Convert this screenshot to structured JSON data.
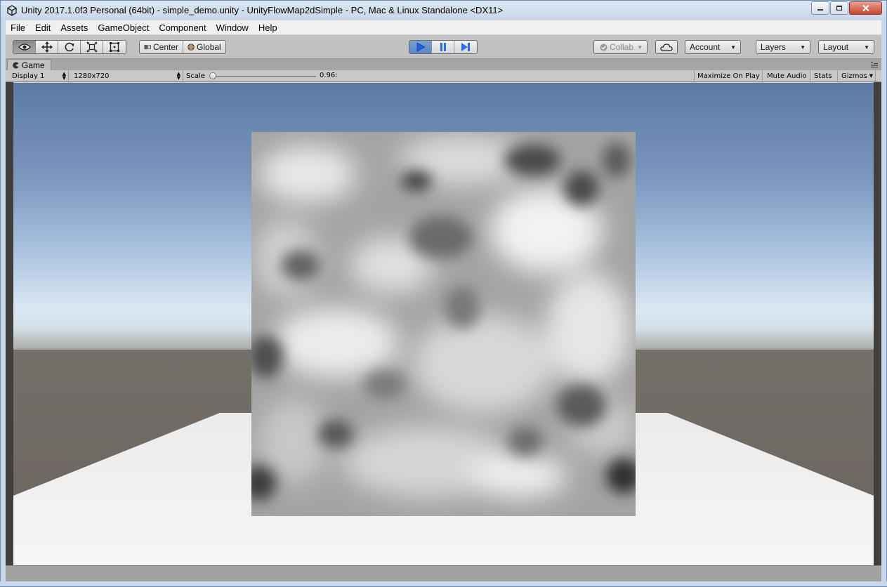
{
  "window": {
    "title": "Unity 2017.1.0f3 Personal (64bit) - simple_demo.unity - UnityFlowMap2dSimple - PC, Mac & Linux Standalone <DX11>",
    "app_icon": "unity-logo-icon",
    "controls": [
      "minimize-icon",
      "maximize-icon",
      "close-icon"
    ]
  },
  "menu": {
    "items": [
      "File",
      "Edit",
      "Assets",
      "GameObject",
      "Component",
      "Window",
      "Help"
    ]
  },
  "toolbar": {
    "tools": [
      {
        "icon": "eye-icon",
        "active": true
      },
      {
        "icon": "move-icon",
        "active": false
      },
      {
        "icon": "rotate-icon",
        "active": false
      },
      {
        "icon": "scale-icon",
        "active": false
      },
      {
        "icon": "rect-tool-icon",
        "active": false
      }
    ],
    "pivot_label": "Center",
    "space_label": "Global",
    "play": {
      "play_active": true,
      "pause_active": false,
      "icons": [
        "play-icon",
        "pause-icon",
        "step-icon"
      ]
    },
    "collab_label": "Collab",
    "account_label": "Account",
    "layers_label": "Layers",
    "layout_label": "Layout",
    "accent_color": "#3a6fd8"
  },
  "game_view": {
    "tab_label": "Game",
    "display": "Display 1",
    "resolution": "1280x720",
    "scale_label": "Scale",
    "scale_value": "0.96:",
    "maximize_on_play": "Maximize On Play",
    "mute_audio": "Mute Audio",
    "stats": "Stats",
    "gizmos": "Gizmos"
  }
}
